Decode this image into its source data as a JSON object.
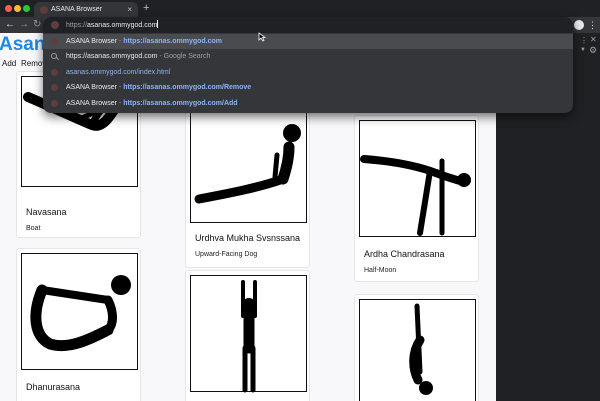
{
  "browser": {
    "tab_title": "ASANA Browser",
    "tab_close": "×",
    "new_tab": "+",
    "address": {
      "scheme": "https://",
      "typed": "asanas.ommygod.com"
    },
    "suggestions": [
      {
        "title": "ASANA Browser",
        "sep": " - ",
        "url": "https://asanas.ommygod.com",
        "kind": "site"
      },
      {
        "title": "https://asanas.ommygod.com",
        "sep": " - ",
        "url": "Google Search",
        "kind": "search"
      },
      {
        "title": "",
        "sep": "",
        "url": "asanas.ommygod.com/index.html",
        "kind": "site"
      },
      {
        "title": "ASANA Browser",
        "sep": " - ",
        "url": "https://asanas.ommygod.com/Remove",
        "kind": "site"
      },
      {
        "title": "ASANA Browser",
        "sep": " - ",
        "url": "https://asanas.ommygod.com/Add",
        "kind": "site"
      }
    ],
    "icons": {
      "back": "arrow-left-icon",
      "forward": "arrow-right-icon",
      "reload": "reload-icon",
      "menu": "kebab-menu-icon",
      "profile": "profile-icon",
      "settings": "gear-icon"
    }
  },
  "page": {
    "title": "Asanas",
    "nav": {
      "add": "Add",
      "remove": "Remove"
    },
    "accent_color": "#1e88e5",
    "cards": [
      {
        "name": "Navasana",
        "meaning": "Boat"
      },
      {
        "name": "Urdhva Mukha Svsnssana",
        "meaning": "Upward-Facing Dog"
      },
      {
        "name": "Ardha Chandrasana",
        "meaning": "Half-Moon"
      },
      {
        "name": "Dhanurasana",
        "meaning": ""
      },
      {
        "name": "",
        "meaning": ""
      },
      {
        "name": "",
        "meaning": ""
      }
    ]
  }
}
